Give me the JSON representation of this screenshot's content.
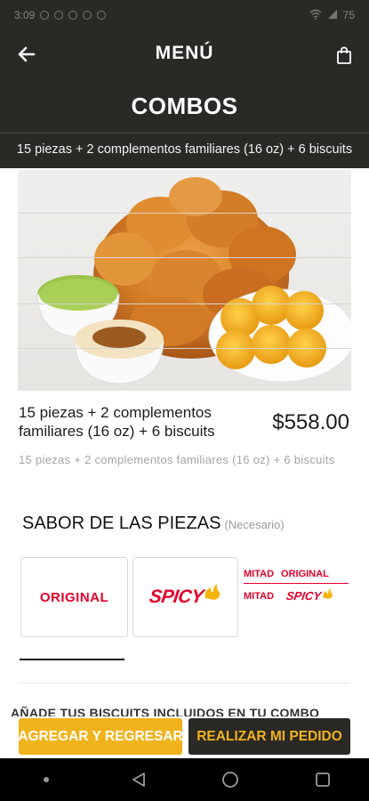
{
  "status_bar": {
    "time": "3:09",
    "battery": "75"
  },
  "header": {
    "title": "MENÚ",
    "back_icon": "arrow-left-icon",
    "bag_icon": "shopping-bag-icon",
    "section": "COMBOS",
    "subtitle": "15 piezas + 2 complementos familiares (16 oz)  + 6 biscuits"
  },
  "product": {
    "name": "15 piezas + 2 complementos familiares (16 oz)  + 6 biscuits",
    "price": "$558.00",
    "description": "15 piezas + 2 complementos familiares (16 oz) + 6 biscuits"
  },
  "flavor": {
    "heading": "SABOR DE LAS PIEZAS",
    "required": "(Necesario)",
    "options": [
      {
        "label": "ORIGINAL"
      },
      {
        "label": "SPICY"
      },
      {
        "line1_prefix": "MITAD",
        "line1_value": "ORIGINAL",
        "line2_prefix": "MITAD",
        "line2_value": "SPICY"
      }
    ]
  },
  "next_section": {
    "heading": "AÑADE TUS BISCUITS INCLUIDOS EN TU COMBO"
  },
  "actions": {
    "add_label": "AGREGAR Y REGRESAR",
    "order_label": "REALIZAR MI PEDIDO"
  },
  "colors": {
    "brand_red": "#e4002b",
    "accent_yellow": "#f0b31c",
    "header_dark": "#2b2926"
  }
}
